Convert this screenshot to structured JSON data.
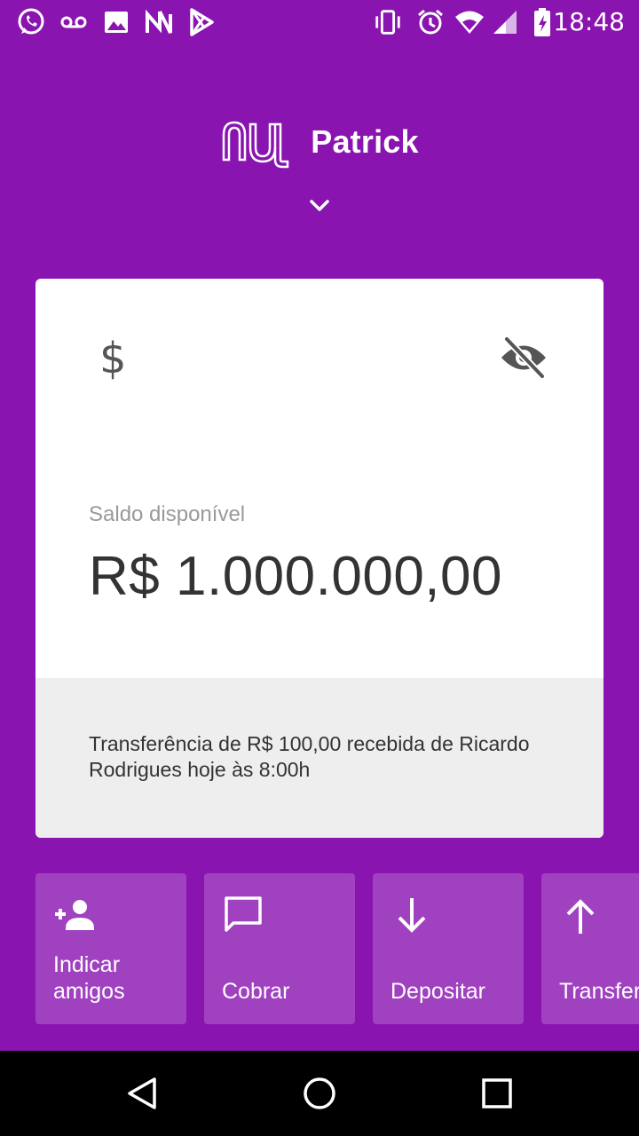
{
  "status_bar": {
    "time": "18:48",
    "left_icons": [
      "whatsapp-icon",
      "voicemail-icon",
      "image-icon",
      "nubank-icon",
      "play-store-icon"
    ],
    "right_icons": [
      "vibrate-icon",
      "alarm-icon",
      "wifi-icon",
      "signal-icon",
      "battery-charging-icon"
    ]
  },
  "header": {
    "account_name": "Patrick",
    "logo_icon": "nu-logo-icon",
    "chevron_icon": "chevron-down-icon"
  },
  "card": {
    "section_icon": "dollar-icon",
    "section_symbol": "$",
    "visibility_icon": "eye-off-icon",
    "balance_label": "Saldo disponível",
    "balance_value": "R$ 1.000.000,00",
    "notice": "Transferência de R$ 100,00 recebida de Ricardo Rodrigues hoje às 8:00h"
  },
  "shortcuts": [
    {
      "label": "Indicar\namigos",
      "icon": "person-add-icon"
    },
    {
      "label": "Cobrar",
      "icon": "chat-bubble-icon"
    },
    {
      "label": "Depositar",
      "icon": "arrow-down-icon"
    },
    {
      "label": "Transferir",
      "icon": "arrow-up-icon"
    }
  ],
  "colors": {
    "brand": "#8a14b0",
    "shortcut_bg": "#a041c0",
    "card_footer": "#eeeeee"
  },
  "nav_bar": {
    "icons": [
      "back-icon",
      "home-icon",
      "recents-icon"
    ]
  }
}
